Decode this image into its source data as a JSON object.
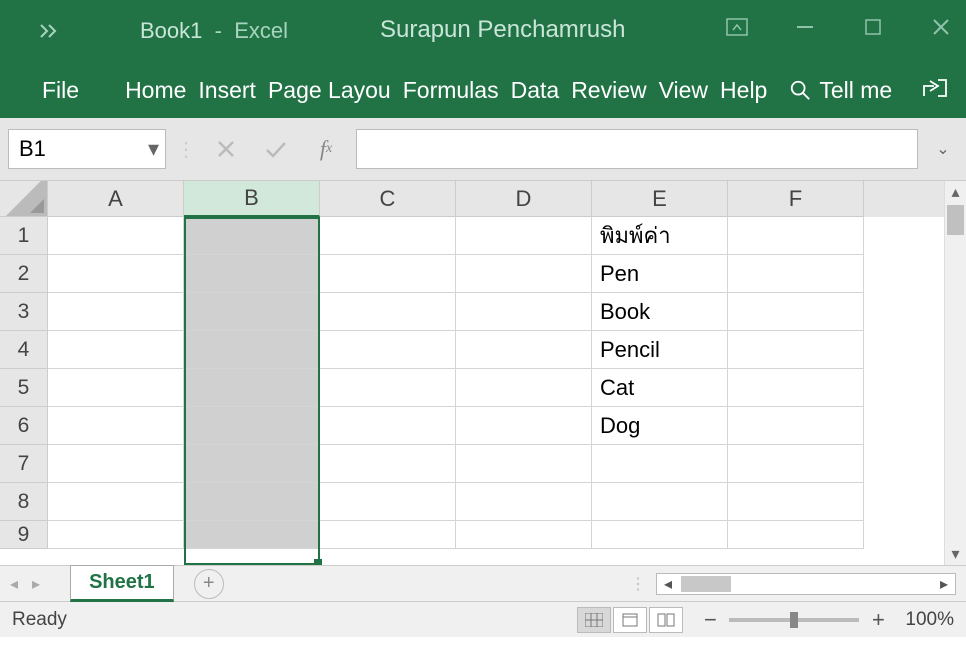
{
  "title": {
    "doc": "Book1",
    "sep": "-",
    "app": "Excel"
  },
  "user": "Surapun Penchamrush",
  "ribbon": {
    "tabs": [
      "File",
      "Home",
      "Insert",
      "Page Layou",
      "Formulas",
      "Data",
      "Review",
      "View",
      "Help"
    ],
    "tellme": "Tell me"
  },
  "namebox": "B1",
  "formula": "",
  "columns": [
    "A",
    "B",
    "C",
    "D",
    "E",
    "F"
  ],
  "selected_column": "B",
  "active_cell": "B1",
  "rows": [
    1,
    2,
    3,
    4,
    5,
    6,
    7,
    8,
    9
  ],
  "cells": {
    "E1": "พิมพ์ค่า",
    "E2": "Pen",
    "E3": "Book",
    "E4": "Pencil",
    "E5": "Cat",
    "E6": "Dog"
  },
  "sheet": {
    "active": "Sheet1"
  },
  "status": {
    "text": "Ready",
    "zoom": "100%"
  }
}
